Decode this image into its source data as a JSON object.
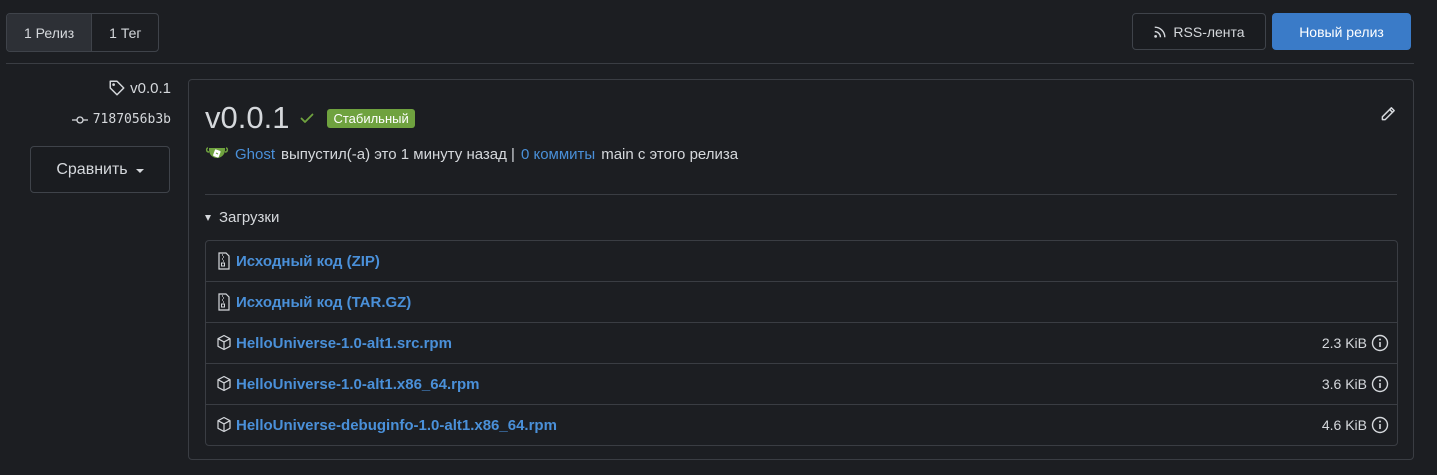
{
  "header": {
    "tabs": [
      {
        "label": "1 Релиз",
        "active": true
      },
      {
        "label": "1 Тег",
        "active": false
      }
    ],
    "rss_label": "RSS-лента",
    "new_release_label": "Новый релиз"
  },
  "sidebar": {
    "tag": "v0.0.1",
    "commit": "7187056b3b",
    "compare_label": "Сравнить"
  },
  "release": {
    "title": "v0.0.1",
    "badge": "Стабильный",
    "author": "Ghost",
    "published_text": "выпустил(-а) это 1 минуту назад |",
    "commits_link": "0 коммиты",
    "commits_suffix": "main с этого релиза",
    "downloads_label": "Загрузки",
    "assets": [
      {
        "name": "Исходный код (ZIP)",
        "icon": "file-zip-icon",
        "size": ""
      },
      {
        "name": "Исходный код (TAR.GZ)",
        "icon": "file-zip-icon",
        "size": ""
      },
      {
        "name": "HelloUniverse-1.0-alt1.src.rpm",
        "icon": "package-icon",
        "size": "2.3 KiB"
      },
      {
        "name": "HelloUniverse-1.0-alt1.x86_64.rpm",
        "icon": "package-icon",
        "size": "3.6 KiB"
      },
      {
        "name": "HelloUniverse-debuginfo-1.0-alt1.x86_64.rpm",
        "icon": "package-icon",
        "size": "4.6 KiB"
      }
    ]
  },
  "colors": {
    "accent": "#3a7bc8",
    "link": "#4a90d9",
    "stable_badge": "#6fa23f",
    "background": "#1c1e22"
  }
}
